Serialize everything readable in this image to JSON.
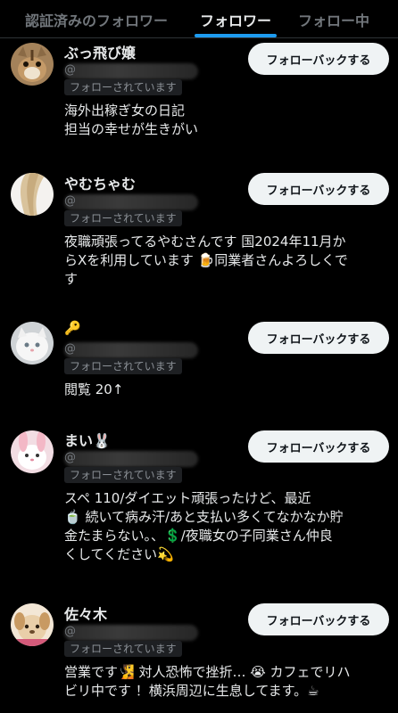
{
  "tabs": [
    {
      "label": "認証済みのフォロワー",
      "active": false
    },
    {
      "label": "フォロワー",
      "active": true
    },
    {
      "label": "フォロー中",
      "active": false
    }
  ],
  "accent_color": "#1d9bf0",
  "follow_back_label": "フォローバックする",
  "follows_you_label": "フォローされています",
  "users": [
    {
      "name": "ぶっ飛び嬢",
      "avatar_icon": "chipmunk-avatar",
      "bio_lines": [
        "海外出稼ぎ女の日記",
        "担当の幸せが生きがい"
      ]
    },
    {
      "name": "やむちゃむ",
      "avatar_icon": "blonde-hair-avatar",
      "bio_lines": [
        "夜職頑張ってるやむさんです 国2024年11月か",
        "らXを利用しています 🍺同業者さんよろしくで",
        "す"
      ]
    },
    {
      "name": "🔑",
      "avatar_icon": "white-kitten-avatar",
      "bio_lines": [
        "閲覧 20↑"
      ]
    },
    {
      "name": "まい🐰",
      "avatar_icon": "pink-bunny-plush-avatar",
      "bio_lines": [
        "スペ 110/ダイエット頑張ったけど、最近",
        "🍵 続いて病み汗/あと支払い多くてなかなか貯",
        "金たまらない。、💲/夜職女の子同業さん仲良",
        "くしてください💫"
      ]
    },
    {
      "name": "佐々木",
      "avatar_icon": "cartoon-dog-avatar",
      "bio_lines": [
        "営業です🧏 対人恐怖で挫折… 😭 カフェでリハ",
        "ビリ中です ！横浜周辺に生息してます。☕"
      ]
    }
  ]
}
